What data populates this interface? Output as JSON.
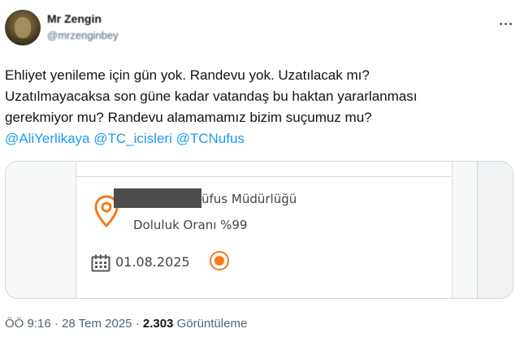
{
  "author": {
    "display_name": "Mr Zengin",
    "handle": "@mrzenginbey"
  },
  "tweet": {
    "lines": [
      "Ehliyet yenileme için gün yok. Randevu yok. Uzatılacak mı?",
      "Uzatılmayacaksa son güne kadar vatandaş bu haktan yararlanması",
      "gerekmiyor mu? Randevu alamamamız bizim suçumuz mu?"
    ],
    "mentions": [
      "@AliYerlikaya",
      "@TC_icisleri",
      "@TCNufus"
    ]
  },
  "media": {
    "office_name": "üfus Müdürlüğü",
    "occupancy": "Doluluk Oranı %99",
    "date": "01.08.2025",
    "accent_color": "#f47a20",
    "icons": [
      "location-pin-icon",
      "calendar-icon"
    ]
  },
  "meta": {
    "time": "ÖÖ 9:16",
    "date": "28 Tem 2025",
    "views": "2.303",
    "views_label": "Görüntüleme",
    "separator": "·"
  },
  "colors": {
    "link": "#1d9bf0",
    "text": "#0f1419",
    "secondary": "#536471"
  }
}
